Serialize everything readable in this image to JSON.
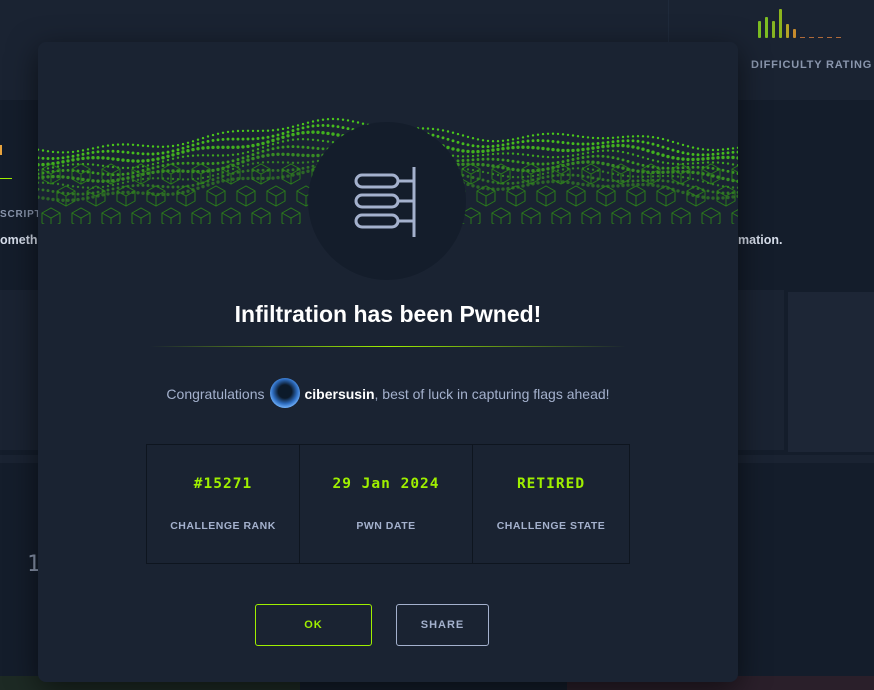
{
  "background": {
    "difficulty_label": "DIFFICULTY RATING",
    "description_fragment": "SCRIPT",
    "left_text_fragment": "omething",
    "right_text_fragment": "mation.",
    "number_fragment": "1",
    "difficulty_bars": [
      {
        "level": 0.55,
        "color": "#7cbd22"
      },
      {
        "level": 0.7,
        "color": "#7cbd22"
      },
      {
        "level": 0.55,
        "color": "#86b421"
      },
      {
        "level": 0.95,
        "color": "#8db51d"
      },
      {
        "level": 0.45,
        "color": "#b5a426"
      },
      {
        "level": 0.3,
        "color": "#c68b2d"
      }
    ]
  },
  "modal": {
    "title": "Infiltration has been Pwned!",
    "icon": "challenge-category-icon",
    "congrats_prefix": "Congratulations",
    "username": "cibersusin",
    "congrats_suffix": ", best of luck in capturing flags ahead!",
    "stats": [
      {
        "value": "#15271",
        "label": "CHALLENGE RANK"
      },
      {
        "value": "29 Jan 2024",
        "label": "PWN DATE"
      },
      {
        "value": "RETIRED",
        "label": "CHALLENGE STATE"
      }
    ],
    "ok_label": "OK",
    "share_label": "SHARE"
  },
  "colors": {
    "accent": "#9fef00",
    "modal_bg": "#1a2332",
    "page_bg": "#141d2b",
    "text_muted": "#a4b1cd"
  }
}
